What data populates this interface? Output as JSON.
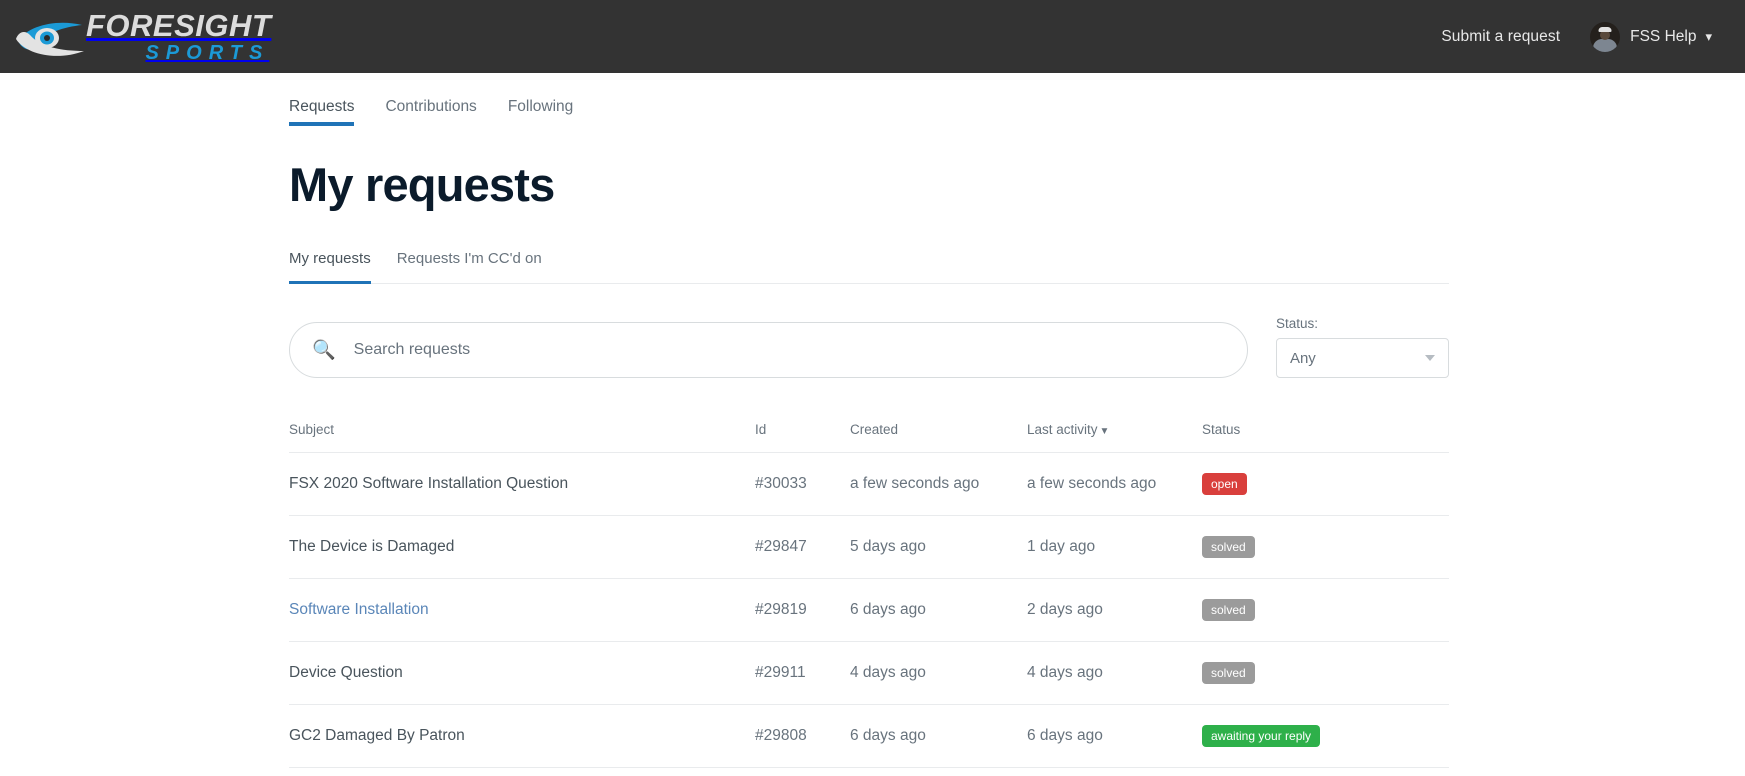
{
  "header": {
    "logo": {
      "top_text": "FORESIGHT",
      "bottom_text": "SPORTS",
      "mark_icon": "foresight-eye-swoosh-icon"
    },
    "submit_request_label": "Submit a request",
    "user_name": "FSS Help",
    "avatar_icon": "user-avatar",
    "chevron_icon": "chevron-down-icon",
    "background_color": "#333333"
  },
  "topnav": {
    "items": [
      {
        "label": "Requests",
        "active": true
      },
      {
        "label": "Contributions",
        "active": false
      },
      {
        "label": "Following",
        "active": false
      }
    ],
    "active_underline_color": "#1f73b7"
  },
  "page": {
    "title": "My requests"
  },
  "subtabs": {
    "items": [
      {
        "label": "My requests",
        "active": true
      },
      {
        "label": "Requests I'm CC'd on",
        "active": false
      }
    ]
  },
  "search": {
    "placeholder": "Search requests",
    "value": "",
    "icon": "search-icon"
  },
  "status_filter": {
    "label": "Status:",
    "selected": "Any",
    "caret_icon": "caret-down-icon"
  },
  "table": {
    "columns": [
      {
        "key": "subject",
        "label": "Subject"
      },
      {
        "key": "id",
        "label": "Id"
      },
      {
        "key": "created",
        "label": "Created"
      },
      {
        "key": "activity",
        "label": "Last activity",
        "sorted": true,
        "sort_arrow": "▼"
      },
      {
        "key": "status",
        "label": "Status"
      }
    ],
    "rows": [
      {
        "subject": "FSX 2020 Software Installation Question",
        "subject_style": "visited",
        "id": "#30033",
        "created": "a few seconds ago",
        "activity": "a few seconds ago",
        "status": "open",
        "status_class": "badge-open"
      },
      {
        "subject": "The Device is Damaged",
        "subject_style": "visited",
        "id": "#29847",
        "created": "5 days ago",
        "activity": "1 day ago",
        "status": "solved",
        "status_class": "badge-solved"
      },
      {
        "subject": "Software Installation",
        "subject_style": "unvisited",
        "id": "#29819",
        "created": "6 days ago",
        "activity": "2 days ago",
        "status": "solved",
        "status_class": "badge-solved"
      },
      {
        "subject": "Device Question",
        "subject_style": "visited",
        "id": "#29911",
        "created": "4 days ago",
        "activity": "4 days ago",
        "status": "solved",
        "status_class": "badge-solved"
      },
      {
        "subject": "GC2 Damaged By Patron",
        "subject_style": "visited",
        "id": "#29808",
        "created": "6 days ago",
        "activity": "6 days ago",
        "status": "awaiting your reply",
        "status_class": "badge-awaiting"
      }
    ]
  },
  "colors": {
    "accent_blue": "#1f73b7",
    "link_blue": "#5a86b8",
    "status_open": "#d93f3c",
    "status_solved": "#9b9b9b",
    "status_awaiting": "#2eb04a",
    "brand_blue": "#1b9ad6",
    "header_bg": "#333333",
    "title_navy": "#0b1b2b"
  }
}
